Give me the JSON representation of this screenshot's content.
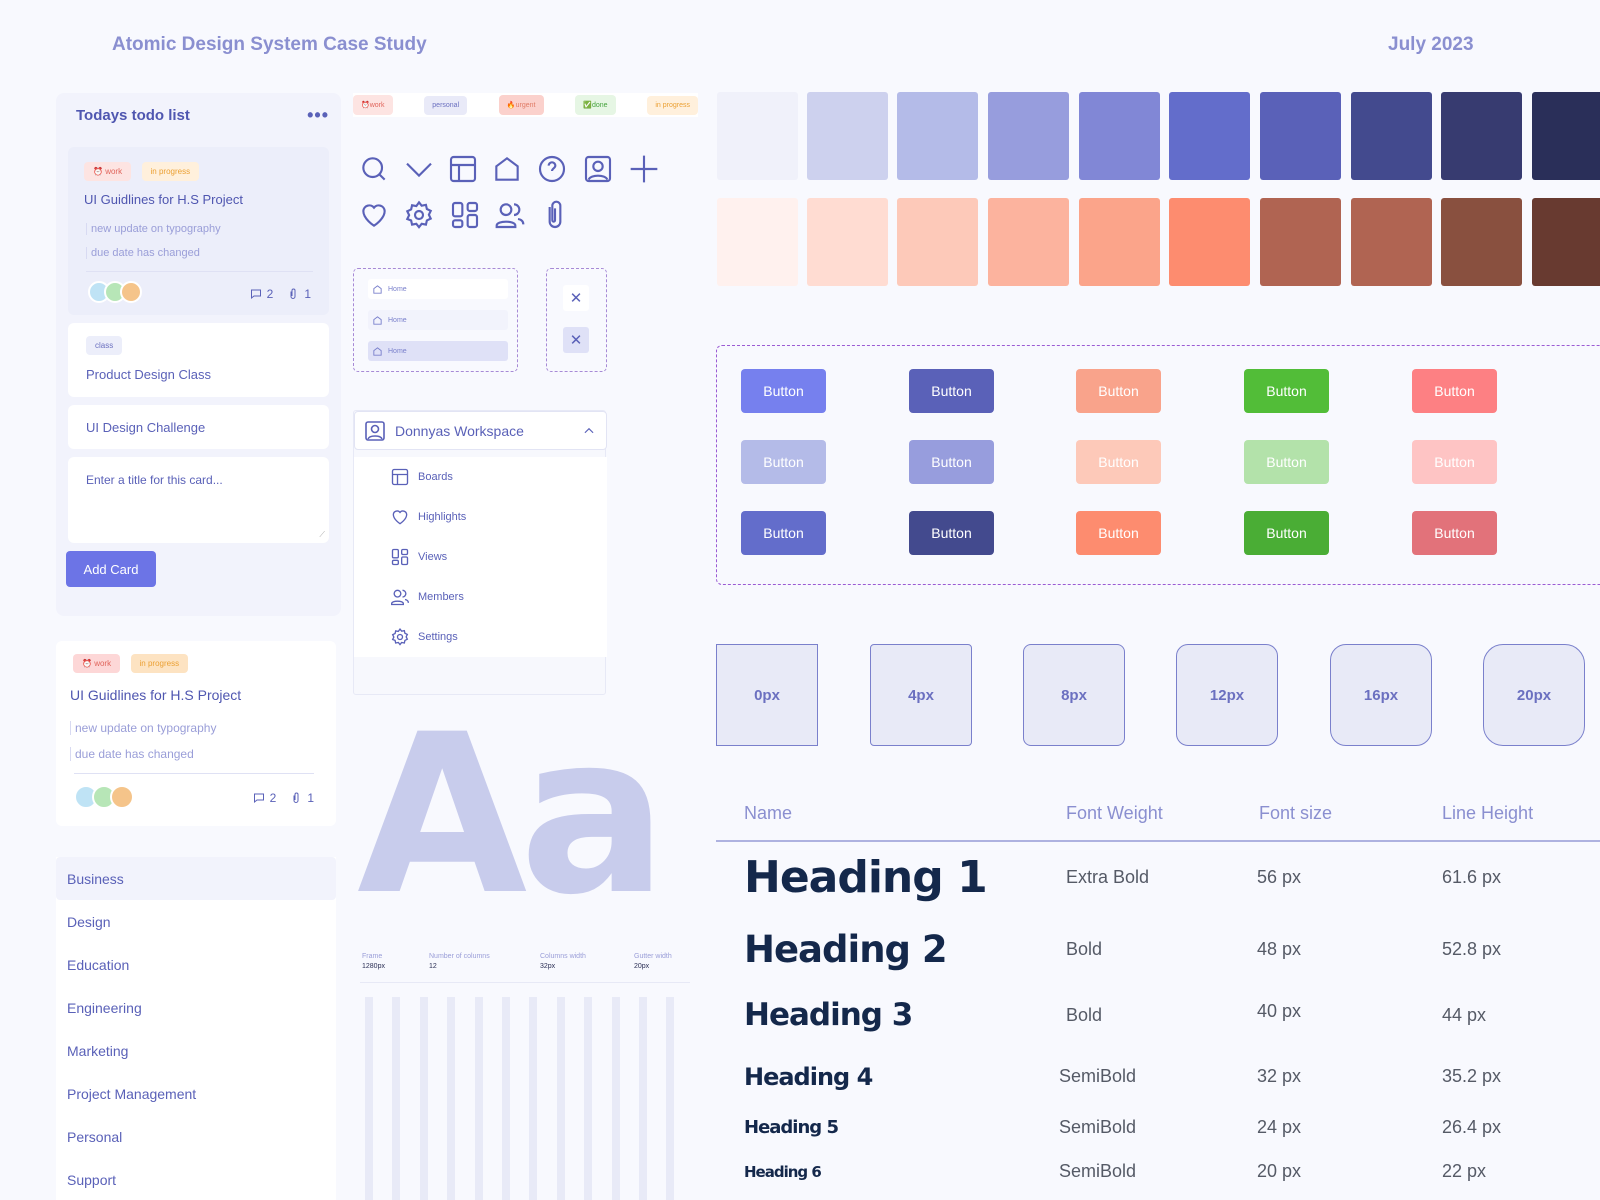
{
  "header": {
    "title": "Atomic Design System Case Study",
    "date": "July 2023"
  },
  "todo_panel": {
    "title": "Todays todo list",
    "more_icon": "more-horizontal-icon",
    "card1": {
      "tags": [
        "work",
        "in progress"
      ],
      "title": "UI Guidlines for H.S Project",
      "lines": [
        "new update on typography",
        "due date has changed"
      ],
      "comments": "2",
      "attachments": "1"
    },
    "card2": {
      "tag": "class",
      "title": "Product Design Class"
    },
    "card3": {
      "title": "UI Design Challenge"
    },
    "input": {
      "placeholder": "Enter a title for this card..."
    },
    "add_button": "Add Card"
  },
  "card_large": {
    "tags": [
      "work",
      "in progress"
    ],
    "title": "UI Guidlines for H.S Project",
    "lines": [
      "new update on typography",
      "due date has changed"
    ],
    "comments": "2",
    "attachments": "1"
  },
  "categories": [
    "Business",
    "Design",
    "Education",
    "Engineering",
    "Marketing",
    "Project Management",
    "Personal",
    "Support"
  ],
  "tag_strip": [
    "work",
    "personal",
    "urgent",
    "done",
    "in progress"
  ],
  "icons": [
    "search-icon",
    "chevron-down-icon",
    "layout-icon",
    "home-icon",
    "help-circle-icon",
    "user-square-icon",
    "plus-icon",
    "heart-icon",
    "settings-icon",
    "grid-icon",
    "users-icon",
    "paperclip-icon"
  ],
  "nav_demo": {
    "items": [
      "Home",
      "Home",
      "Home"
    ]
  },
  "workspace": {
    "name": "Donnyas Workspace",
    "items": [
      "Boards",
      "Highlights",
      "Views",
      "Members",
      "Settings"
    ]
  },
  "typeface_sample": "Aa",
  "grid_spec": {
    "labels": [
      "Frame",
      "Number of columns",
      "Columns width",
      "Gutter width"
    ],
    "values": [
      "1280px",
      "12",
      "32px",
      "20px"
    ],
    "columns": 12
  },
  "palette": {
    "primary": [
      "#f0f1fa",
      "#cdd1ee",
      "#b4bbe8",
      "#979ddd",
      "#8187d6",
      "#636dcb",
      "#5a61b8",
      "#434a8e",
      "#373b70",
      "#2a2f59"
    ],
    "secondary": [
      "#fff1ee",
      "#ffdcd2",
      "#fdc9b9",
      "#fcb39e",
      "#fba48a",
      "#fd8c6f",
      "#b06452",
      "#b06452",
      "#89503f",
      "#683a30"
    ]
  },
  "buttons": {
    "label": "Button",
    "rows": [
      [
        "#7680ee",
        "#5a61b8",
        "#f9a38b",
        "#52bd38",
        "#fd8083"
      ],
      [
        "#b4bbe8",
        "#979ddd",
        "#fdc9b9",
        "#b3e2aa",
        "#fec4c4"
      ],
      [
        "#636dcb",
        "#434a8e",
        "#fd8c6f",
        "#4aad35",
        "#e2727a"
      ]
    ]
  },
  "radii": [
    "0px",
    "4px",
    "8px",
    "12px",
    "16px",
    "20px"
  ],
  "type_table": {
    "headers": [
      "Name",
      "Font Weight",
      "Font size",
      "Line Height"
    ],
    "rows": [
      {
        "name": "Heading 1",
        "weight": "Extra Bold",
        "size": "56 px",
        "line": "61.6 px"
      },
      {
        "name": "Heading 2",
        "weight": "Bold",
        "size": "48 px",
        "line": "52.8 px"
      },
      {
        "name": "Heading 3",
        "weight": "Bold",
        "size": "40 px",
        "line": "44 px"
      },
      {
        "name": "Heading 4",
        "weight": "SemiBold",
        "size": "32 px",
        "line": "35.2 px"
      },
      {
        "name": "Heading 5",
        "weight": "SemiBold",
        "size": "24 px",
        "line": "26.4 px"
      },
      {
        "name": "Heading 6",
        "weight": "SemiBold",
        "size": "20 px",
        "line": "22 px"
      }
    ]
  }
}
